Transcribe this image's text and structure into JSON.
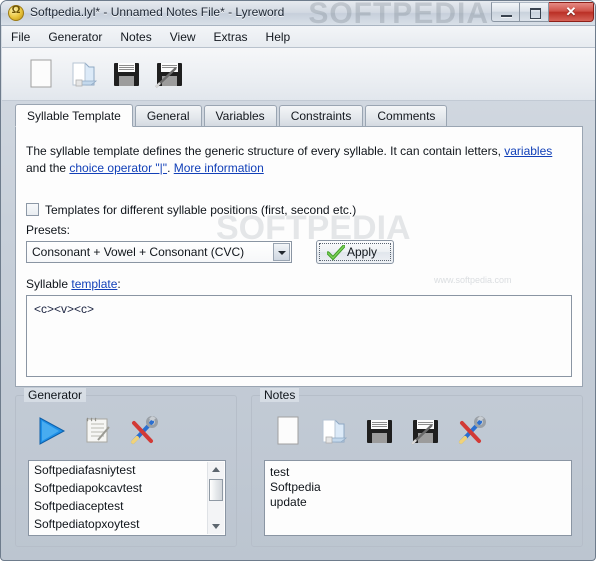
{
  "window": {
    "title": "Softpedia.lyl* - Unnamed Notes File* - Lyreword",
    "watermark": "SOFTPEDIA",
    "app_icon": "lyreword-app-icon",
    "controls": {
      "minimize": "minimize",
      "maximize": "maximize",
      "close": "✕"
    }
  },
  "menubar": {
    "items": [
      {
        "label": "File"
      },
      {
        "label": "Generator"
      },
      {
        "label": "Notes"
      },
      {
        "label": "View"
      },
      {
        "label": "Extras"
      },
      {
        "label": "Help"
      }
    ]
  },
  "toolbar": {
    "buttons": [
      {
        "name": "new-file-icon",
        "title": "New"
      },
      {
        "name": "open-folder-icon",
        "title": "Open"
      },
      {
        "name": "save-icon",
        "title": "Save"
      },
      {
        "name": "save-as-icon",
        "title": "Save As"
      }
    ]
  },
  "tabs": [
    {
      "label": "Syllable Template",
      "active": true
    },
    {
      "label": "General",
      "active": false
    },
    {
      "label": "Variables",
      "active": false
    },
    {
      "label": "Constraints",
      "active": false
    },
    {
      "label": "Comments",
      "active": false
    }
  ],
  "syllable_tab": {
    "description_part1": "The syllable template defines the generic structure of every syllable. It can contain letters, ",
    "description_link1": "variables",
    "description_part2": " and the ",
    "description_link2": "choice operator \"|\"",
    "description_part3": ". ",
    "description_link3": "More information",
    "checkbox": {
      "label": "Templates for different syllable positions (first, second etc.)",
      "checked": false
    },
    "presets_label": "Presets:",
    "preset_selected": "Consonant + Vowel + Consonant (CVC)",
    "apply_button": "Apply",
    "template_label_prefix": "Syllable ",
    "template_label_link": "template",
    "template_label_suffix": ":",
    "template_value": "<c><v><c>",
    "watermark_center": "SOFTPEDIA",
    "watermark_url": "www.softpedia.com"
  },
  "generator_panel": {
    "title": "Generator",
    "buttons": [
      {
        "name": "run-generator-icon",
        "title": "Generate"
      },
      {
        "name": "edit-list-icon",
        "title": "Edit"
      },
      {
        "name": "generator-settings-icon",
        "title": "Settings"
      }
    ],
    "results": [
      "Softpediafasniytest",
      "Softpediapokcavtest",
      "Softpediaceptest",
      "Softpediatopxoytest"
    ]
  },
  "notes_panel": {
    "title": "Notes",
    "buttons": [
      {
        "name": "notes-new-icon",
        "title": "New"
      },
      {
        "name": "notes-open-icon",
        "title": "Open"
      },
      {
        "name": "notes-save-icon",
        "title": "Save"
      },
      {
        "name": "notes-save-as-icon",
        "title": "Save As"
      },
      {
        "name": "notes-settings-icon",
        "title": "Settings"
      }
    ],
    "lines": [
      "test",
      "Softpedia",
      "update"
    ]
  },
  "colors": {
    "accent_blue": "#1240b8",
    "close_red": "#ba2f25",
    "window_bg": "#d5dce4",
    "panel_white": "#fdfdfd"
  }
}
